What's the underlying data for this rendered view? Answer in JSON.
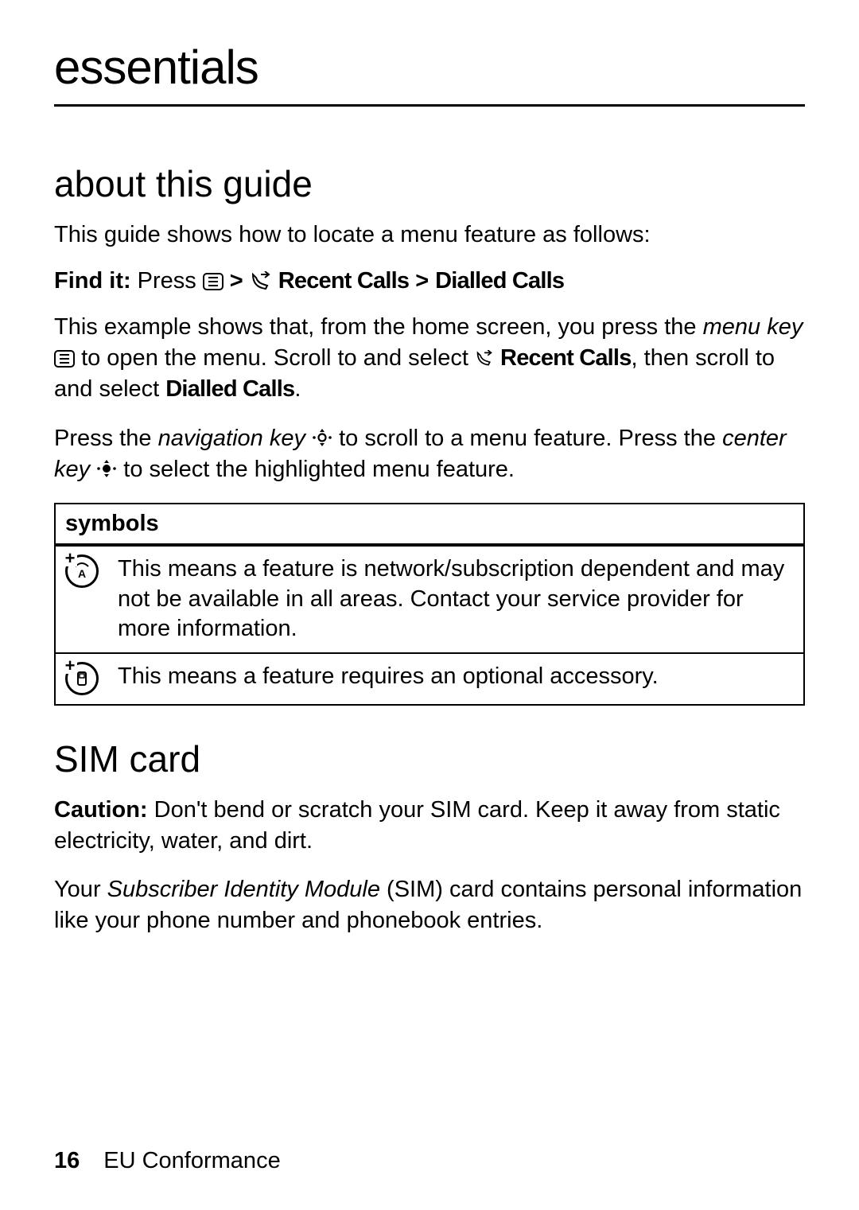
{
  "title": "essentials",
  "section1": {
    "heading": "about this guide",
    "intro": "This guide shows how to locate a menu feature as follows:",
    "find_it_label": "Find it:",
    "find_it_press": "Press",
    "find_gt1": ">",
    "find_recent": "Recent Calls",
    "find_gt2": ">",
    "find_dialled": "Dialled Calls",
    "explain_p1_a": "This example shows that, from the home screen, you press the ",
    "explain_p1_menukey": "menu key",
    "explain_p1_b": " to open the menu. Scroll to and select ",
    "explain_p1_recent": "Recent Calls",
    "explain_p1_c": ", then scroll to and select ",
    "explain_p1_dialled": "Dialled Calls",
    "explain_p1_d": ".",
    "explain_p2_a": "Press the ",
    "explain_p2_nav": "navigation key",
    "explain_p2_b": " to scroll to a menu feature. Press the ",
    "explain_p2_center": "center key",
    "explain_p2_c": " to select the highlighted menu feature."
  },
  "symbols": {
    "header": "symbols",
    "rows": [
      {
        "icon": "network",
        "text": "This means a feature is network/subscription dependent and may not be available in all areas. Contact your service provider for more information."
      },
      {
        "icon": "accessory",
        "text": "This means a feature requires an optional accessory."
      }
    ]
  },
  "section2": {
    "heading": "SIM card",
    "p1_a": "Caution:",
    "p1_b": " Don't bend or scratch your SIM card. Keep it away from static electricity, water, and dirt.",
    "p2_a": "Your ",
    "p2_b": "Subscriber Identity Module",
    "p2_c": " (SIM) card contains personal information like your phone number and phonebook entries."
  },
  "footer": {
    "page": "16",
    "section": "EU Conformance"
  }
}
